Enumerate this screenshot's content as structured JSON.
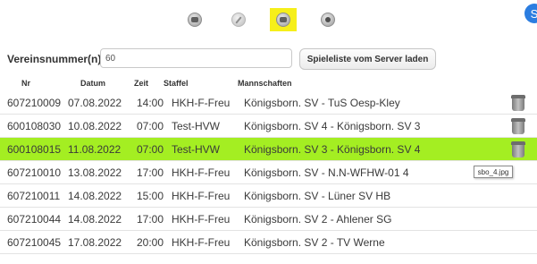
{
  "toolbar": {
    "buttons": [
      {
        "icon": "list-icon",
        "active": false
      },
      {
        "icon": "pencil-icon",
        "active": false
      },
      {
        "icon": "list-icon",
        "active": true
      },
      {
        "icon": "record-icon",
        "active": false
      }
    ],
    "active_color": "#f6ef1a",
    "corner_icon_glyph": "S"
  },
  "form": {
    "label": "Vereinsnummer(n):",
    "input_value": "60",
    "load_button": "Spieleliste vom Server laden"
  },
  "table": {
    "headers": {
      "nr": "Nr",
      "datum": "Datum",
      "zeit": "Zeit",
      "staffel": "Staffel",
      "mannschaften": "Mannschaften"
    },
    "highlight_color": "#a4ee22",
    "rows": [
      {
        "nr": "607210009",
        "datum": "07.08.2022",
        "zeit": "14:00",
        "staffel": "HKH-F-Freu",
        "mannschaften": "Königsborn. SV - TuS Oesp-Kley"
      },
      {
        "nr": "600108030",
        "datum": "10.08.2022",
        "zeit": "07:00",
        "staffel": "Test-HVW",
        "mannschaften": "Königsborn. SV 4 - Königsborn. SV 3"
      },
      {
        "nr": "600108015",
        "datum": "11.08.2022",
        "zeit": "07:00",
        "staffel": "Test-HVW",
        "mannschaften": "Königsborn. SV 3 - Königsborn. SV 4"
      },
      {
        "nr": "607210010",
        "datum": "13.08.2022",
        "zeit": "17:00",
        "staffel": "HKH-F-Freu",
        "mannschaften": "Königsborn. SV - N.N-WFHW-01 4"
      },
      {
        "nr": "607210011",
        "datum": "14.08.2022",
        "zeit": "15:00",
        "staffel": "HKH-F-Freu",
        "mannschaften": "Königsborn. SV - Lüner SV HB"
      },
      {
        "nr": "607210044",
        "datum": "14.08.2022",
        "zeit": "17:00",
        "staffel": "HKH-F-Freu",
        "mannschaften": "Königsborn. SV 2 - Ahlener SG"
      },
      {
        "nr": "607210045",
        "datum": "17.08.2022",
        "zeit": "20:00",
        "staffel": "HKH-F-Freu",
        "mannschaften": "Königsborn. SV 2 - TV Werne"
      }
    ],
    "tooltip": "sbo_4.jpg"
  }
}
